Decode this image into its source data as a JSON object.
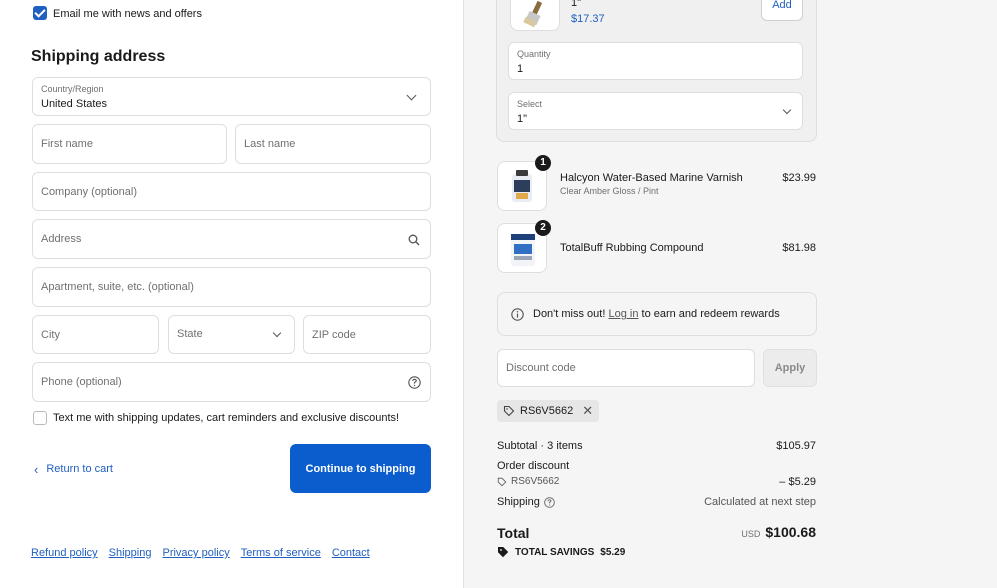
{
  "checkout": {
    "email_optin_label": "Email me with news and offers",
    "shipping_heading": "Shipping address",
    "country": {
      "label": "Country/Region",
      "value": "United States"
    },
    "first_name_placeholder": "First name",
    "last_name_placeholder": "Last name",
    "company_placeholder": "Company (optional)",
    "address_placeholder": "Address",
    "apartment_placeholder": "Apartment, suite, etc. (optional)",
    "city_placeholder": "City",
    "state_placeholder": "State",
    "zip_placeholder": "ZIP code",
    "phone_placeholder": "Phone (optional)",
    "sms_optin_label": "Text me with shipping updates, cart reminders and exclusive discounts!",
    "return_link": "Return to cart",
    "continue_button": "Continue to shipping",
    "footer_links": [
      "Refund policy",
      "Shipping",
      "Privacy policy",
      "Terms of service",
      "Contact"
    ]
  },
  "upsell": {
    "variant_name": "1\"",
    "price": "$17.37",
    "add_button": "Add",
    "quantity_label": "Quantity",
    "quantity_value": "1",
    "select_label": "Select",
    "select_value": "1\""
  },
  "cart": {
    "items": [
      {
        "qty": "1",
        "name": "Halcyon Water-Based Marine Varnish",
        "variant": "Clear Amber Gloss / Pint",
        "price": "$23.99"
      },
      {
        "qty": "2",
        "name": "TotalBuff Rubbing Compound",
        "variant": "",
        "price": "$81.98"
      }
    ],
    "rewards": {
      "prefix": "Don't miss out! ",
      "link": "Log in",
      "suffix": " to earn and redeem rewards"
    },
    "discount_placeholder": "Discount code",
    "apply_button": "Apply",
    "applied_code": "RS6V5662",
    "summary": {
      "subtotal_label": "Subtotal · 3 items",
      "subtotal_value": "$105.97",
      "order_discount_label": "Order discount",
      "discount_code": "RS6V5662",
      "discount_value": "– $5.29",
      "shipping_label": "Shipping",
      "shipping_value": "Calculated at next step",
      "total_label": "Total",
      "currency": "USD",
      "total_value": "$100.68",
      "savings_label": "TOTAL SAVINGS",
      "savings_value": "$5.29"
    }
  },
  "colors": {
    "accent": "#1f5fbf",
    "panel": "#f5f5f5",
    "border": "#dedede"
  }
}
